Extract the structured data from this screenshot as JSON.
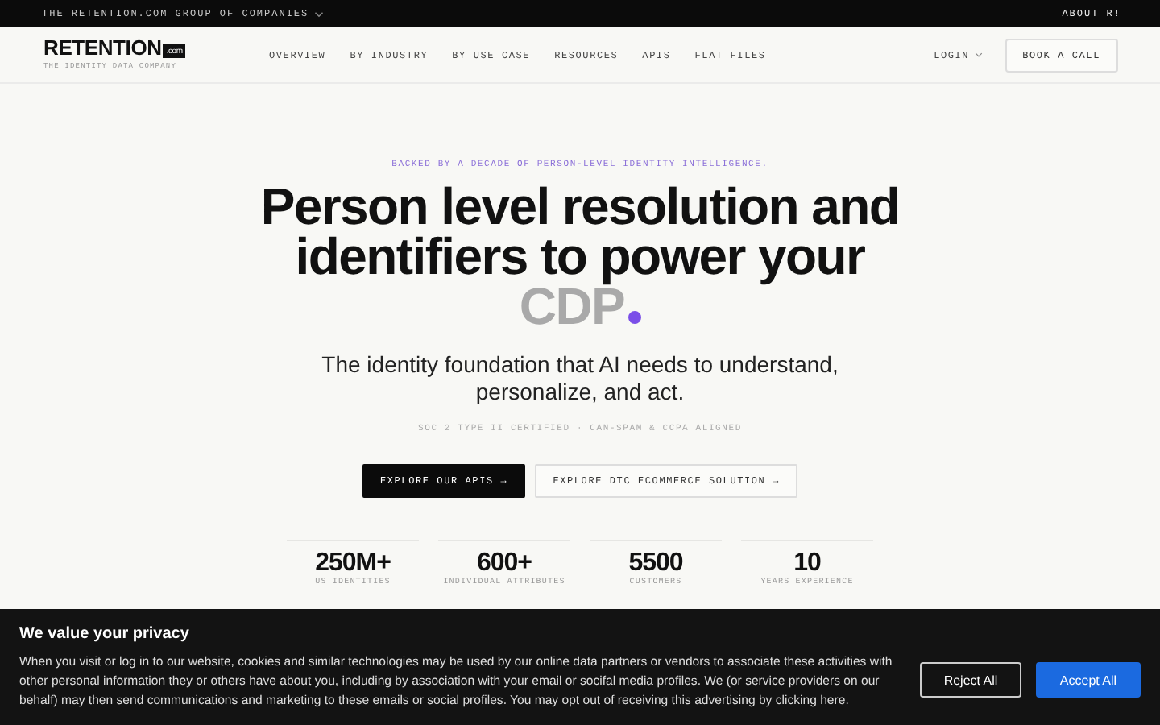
{
  "top_bar": {
    "group_link": "THE RETENTION.COM GROUP OF COMPANIES",
    "about": "ABOUT R!"
  },
  "nav": {
    "logo": "RETENTION",
    "logo_suffix": ".com",
    "tagline": "THE IDENTITY DATA COMPANY",
    "links": [
      "OVERVIEW",
      "BY INDUSTRY",
      "BY USE CASE",
      "RESOURCES",
      "APIS",
      "FLAT FILES"
    ],
    "login": "LOGIN",
    "cta": "BOOK A CALL"
  },
  "hero": {
    "eyebrow": "BACKED BY A DECADE OF PERSON-LEVEL IDENTITY INTELLIGENCE.",
    "headline": "Person level resolution and identifiers to power your",
    "rotating_word": "CDP",
    "subtitle": "The identity foundation that AI needs to understand, personalize, and act.",
    "compliance": "SOC 2 TYPE II CERTIFIED · CAN-SPAM & CCPA ALIGNED",
    "buttons": [
      {
        "label": "EXPLORE OUR APIS →",
        "kind": "primary"
      },
      {
        "label": "EXPLORE DTC ECOMMERCE SOLUTION →",
        "kind": "secondary"
      }
    ]
  },
  "stats": [
    {
      "value": "250M+",
      "label": "US IDENTITIES"
    },
    {
      "value": "600+",
      "label": "INDIVIDUAL ATTRIBUTES"
    },
    {
      "value": "5500",
      "label": "CUSTOMERS"
    },
    {
      "value": "10",
      "label": "YEARS EXPERIENCE"
    }
  ],
  "cookie_banner": {
    "title": "We value your privacy",
    "text": "When you visit or log in to our website, cookies and similar technologies may be used by our online data partners or vendors to associate these activities with other personal information they or others have about you, including by association with your email or socifal media profiles. We (or service providers on our behalf) may then send communications and marketing to these emails or social profiles. You may opt out of receiving this advertising by clicking here.",
    "buttons": [
      {
        "label": "Reject All",
        "kind": "secondary"
      },
      {
        "label": "Accept All",
        "kind": "primary"
      }
    ]
  }
}
